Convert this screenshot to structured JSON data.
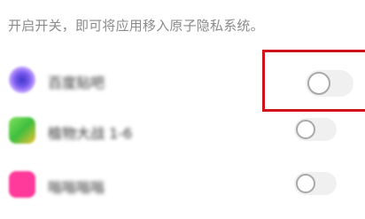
{
  "hint_text": "开启开关，即可将应用移入原子隐私系统。",
  "apps": [
    {
      "name": "百度贴吧",
      "icon": "app-icon-purple",
      "toggle_on": false,
      "color": "#7b5cf0"
    },
    {
      "name": "植物大战 1-6",
      "icon": "app-icon-green",
      "toggle_on": false,
      "color": "#3fbf3f"
    },
    {
      "name": "嗡嗡嗡嗡",
      "icon": "app-icon-pink",
      "toggle_on": false,
      "color": "#ff3a9a"
    }
  ],
  "colors": {
    "highlight": "#d0121c",
    "toggle_track_off": "#f0f0f0",
    "toggle_knob_border": "#a9a9a9",
    "hint_text": "#8a8a8a"
  }
}
